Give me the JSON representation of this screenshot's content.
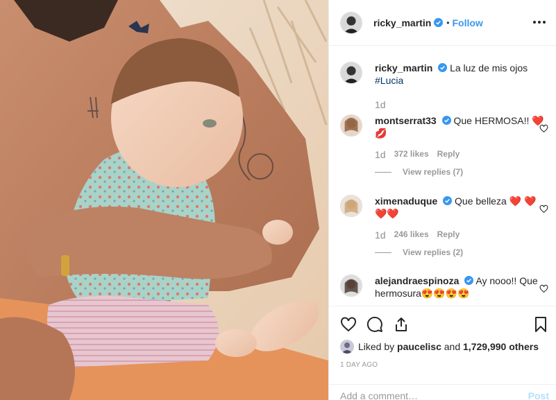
{
  "post": {
    "author": "ricky_martin",
    "follow_label": "Follow",
    "separator": "•",
    "more_label": "More options",
    "caption": {
      "username": "ricky_martin",
      "text": "La luz de mis ojos",
      "hashtag": "#Lucia",
      "time": "1d"
    },
    "comments": [
      {
        "username": "montserrat33",
        "text": "Que HERMOSA!! ❤️💋",
        "time": "1d",
        "likes": "372 likes",
        "reply_label": "Reply",
        "view_replies": "View replies (7)"
      },
      {
        "username": "ximenaduque",
        "text": "Que belleza ❤️ ❤️❤️❤️",
        "time": "1d",
        "likes": "246 likes",
        "reply_label": "Reply",
        "view_replies": "View replies (2)"
      },
      {
        "username": "alejandraespinoza",
        "text": "Ay nooo!! Que hermosura😍😍😍😍"
      }
    ],
    "liked_by": {
      "prefix": "Liked by",
      "user": "paucelisc",
      "middle": "and",
      "others": "1,729,990 others"
    },
    "date": "1 DAY AGO",
    "add_comment_placeholder": "Add a comment…",
    "post_label": "Post"
  },
  "colors": {
    "link_blue": "#3897f0",
    "hashtag": "#003569",
    "muted": "#999999",
    "post_disabled": "#b2dffc"
  }
}
